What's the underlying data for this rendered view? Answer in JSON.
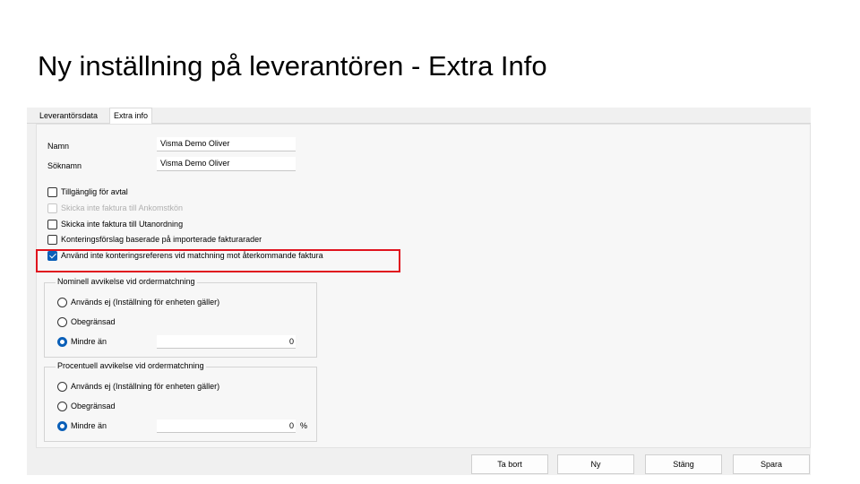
{
  "slide_title": "Ny inställning på leverantören - Extra Info",
  "tabs": [
    {
      "label": "Leverantörsdata",
      "active": false
    },
    {
      "label": "Extra info",
      "active": true
    }
  ],
  "fields": {
    "namn_label": "Namn",
    "namn_value": "Visma Demo Oliver",
    "soknamn_label": "Söknamn",
    "soknamn_value": "Visma Demo Oliver"
  },
  "checkboxes": [
    {
      "label": "Tillgänglig för avtal",
      "checked": false,
      "disabled": false
    },
    {
      "label": "Skicka inte faktura till Ankomstkön",
      "checked": false,
      "disabled": true
    },
    {
      "label": "Skicka inte faktura till Utanordning",
      "checked": false,
      "disabled": false
    },
    {
      "label": "Konteringsförslag baserade på importerade fakturarader",
      "checked": false,
      "disabled": false
    },
    {
      "label": "Använd inte konteringsreferens vid matchning mot återkommande faktura",
      "checked": true,
      "disabled": false
    }
  ],
  "highlight_color": "#e0141e",
  "accent_color": "#0a5fb8",
  "group_nominell": {
    "title": "Nominell avvikelse vid ordermatchning",
    "options": [
      "Används ej (Inställning för enheten gäller)",
      "Obegränsad",
      "Mindre än"
    ],
    "selected": "Mindre än",
    "value": "0"
  },
  "group_procent": {
    "title": "Procentuell avvikelse vid ordermatchning",
    "options": [
      "Används ej (Inställning för enheten gäller)",
      "Obegränsad",
      "Mindre än"
    ],
    "selected": "Mindre än",
    "value": "0",
    "unit": "%"
  },
  "buttons": {
    "ta_bort": "Ta bort",
    "ny": "Ny",
    "stang": "Stäng",
    "spara": "Spara"
  }
}
